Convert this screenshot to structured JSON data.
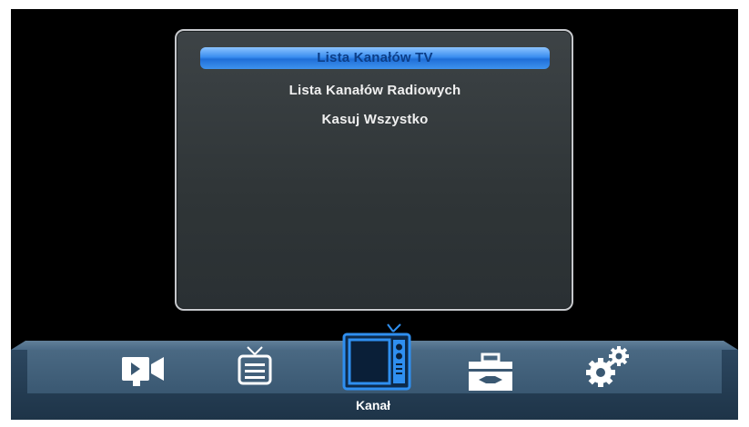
{
  "menu": {
    "items": [
      {
        "label": "Lista Kanałów TV",
        "selected": true
      },
      {
        "label": "Lista Kanałów Radiowych",
        "selected": false
      },
      {
        "label": "Kasuj Wszystko",
        "selected": false
      }
    ]
  },
  "nav": {
    "active_label": "Kanał",
    "icons": [
      "video-icon",
      "tv-guide-icon",
      "tv-channel-icon",
      "toolbox-icon",
      "gears-icon"
    ]
  },
  "colors": {
    "highlight": "#3a8ef0",
    "active_icon": "#2f8ff0",
    "icon_white": "#ffffff",
    "panel_bg": "#2f3537",
    "bar_bg": "#3a5872"
  }
}
